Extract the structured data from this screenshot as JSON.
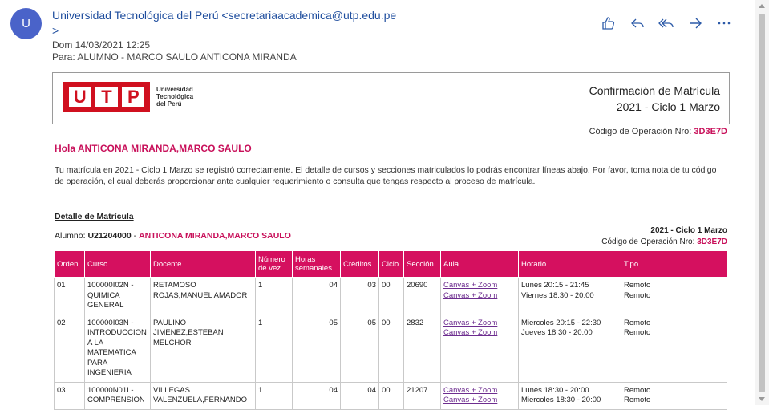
{
  "email": {
    "avatar_letter": "U",
    "sender_line1": "Universidad Tecnológica del Perú <secretariaacademica@utp.edu.pe",
    "sender_line2": ">",
    "date": "Dom 14/03/2021 12:25",
    "to": "Para:  ALUMNO - MARCO SAULO ANTICONA MIRANDA"
  },
  "actions": [
    "like-icon",
    "reply-icon",
    "reply-all-icon",
    "forward-icon",
    "more-icon"
  ],
  "header": {
    "logo_letters": [
      "U",
      "T",
      "P"
    ],
    "logo_text_1": "Universidad",
    "logo_text_2": "Tecnológica",
    "logo_text_3": "del Perú",
    "title_1": "Confirmación de Matrícula",
    "title_2": "2021 - Ciclo 1 Marzo"
  },
  "operation": {
    "label": "Código de Operación Nro: ",
    "code": "3D3E7D"
  },
  "greeting": "Hola ANTICONA MIRANDA,MARCO SAULO",
  "paragraph": "Tu matrícula en 2021 - Ciclo 1 Marzo se registró correctamente. El detalle de cursos y secciones matriculados lo podrás encontrar líneas abajo. Por favor, toma nota de tu código de operación, el cual deberás proporcionar ante cualquier requerimiento o consulta que tengas respecto al proceso de matrícula.",
  "detalle_title": "Detalle de Matrícula",
  "alumno": {
    "label": "Alumno: ",
    "code": "U21204000",
    "sep": " - ",
    "name": "ANTICONA MIRANDA,MARCO SAULO"
  },
  "ciclo": "2021 - Ciclo 1 Marzo",
  "table": {
    "headers": [
      "Orden",
      "Curso",
      "Docente",
      "Número de vez",
      "Horas semanales",
      "Créditos",
      "Ciclo",
      "Sección",
      "Aula",
      "Horario",
      "Tipo"
    ],
    "rows": [
      {
        "orden": "01",
        "curso": "100000I02N - QUIMICA GENERAL",
        "docente": "RETAMOSO ROJAS,MANUEL AMADOR",
        "vez": "1",
        "horas": "04",
        "creditos": "03",
        "ciclo": "00",
        "seccion": "20690",
        "aula1": "Canvas + Zoom",
        "aula2": "Canvas + Zoom",
        "horario1": "Lunes 20:15 - 21:45",
        "horario2": "Viernes 18:30 - 20:00",
        "tipo1": "Remoto",
        "tipo2": "Remoto"
      },
      {
        "orden": "02",
        "curso": "100000I03N - INTRODUCCION A LA MATEMATICA PARA INGENIERIA",
        "docente": "PAULINO JIMENEZ,ESTEBAN MELCHOR",
        "vez": "1",
        "horas": "05",
        "creditos": "05",
        "ciclo": "00",
        "seccion": "2832",
        "aula1": "Canvas + Zoom",
        "aula2": "Canvas + Zoom",
        "horario1": "Miercoles 20:15 - 22:30",
        "horario2": "Jueves 18:30 - 20:00",
        "tipo1": "Remoto",
        "tipo2": "Remoto"
      },
      {
        "orden": "03",
        "curso": "100000N01I - COMPRENSION",
        "docente": "VILLEGAS VALENZUELA,FERNANDO",
        "vez": "1",
        "horas": "04",
        "creditos": "04",
        "ciclo": "00",
        "seccion": "21207",
        "aula1": "Canvas + Zoom",
        "aula2": "Canvas + Zoom",
        "horario1": "Lunes 18:30 - 20:00",
        "horario2": "Miercoles 18:30 - 20:00",
        "tipo1": "Remoto",
        "tipo2": "Remoto"
      }
    ]
  }
}
